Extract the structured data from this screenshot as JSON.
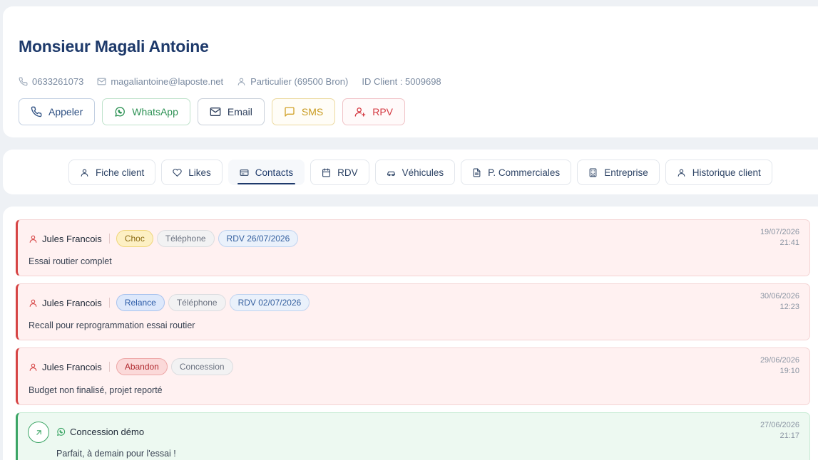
{
  "client": {
    "name": "Monsieur Magali Antoine",
    "phone": "0633261073",
    "email": "magaliantoine@laposte.net",
    "type": "Particulier (69500 Bron)",
    "id": "ID Client : 5009698"
  },
  "actions": {
    "call": "Appeler",
    "whatsapp": "WhatsApp",
    "email": "Email",
    "sms": "SMS",
    "rpv": "RPV"
  },
  "tabs": [
    {
      "label": "Fiche client",
      "icon": "user-icon"
    },
    {
      "label": "Likes",
      "icon": "heart-icon"
    },
    {
      "label": "Contacts",
      "icon": "id-card-icon",
      "active": true
    },
    {
      "label": "RDV",
      "icon": "calendar-icon"
    },
    {
      "label": "Véhicules",
      "icon": "car-icon"
    },
    {
      "label": "P. Commerciales",
      "icon": "document-icon"
    },
    {
      "label": "Entreprise",
      "icon": "building-icon"
    },
    {
      "label": "Historique client",
      "icon": "user-icon"
    }
  ],
  "contacts": [
    {
      "author": "Jules Francois",
      "status": "Choc",
      "channel": "Téléphone",
      "rdv": "RDV 26/07/2026",
      "text": "Essai routier complet",
      "date": "19/07/2026",
      "time": "21:41"
    },
    {
      "author": "Jules Francois",
      "status": "Relance",
      "channel": "Téléphone",
      "rdv": "RDV 02/07/2026",
      "text": "Recall pour reprogrammation essai routier",
      "date": "30/06/2026",
      "time": "12:23"
    },
    {
      "author": "Jules Francois",
      "status": "Abandon",
      "channel": "Concession",
      "text": "Budget non finalisé, projet reporté",
      "date": "29/06/2026",
      "time": "19:10"
    },
    {
      "author": "Concession démo",
      "text": "Parfait, à demain pour l'essai !",
      "date": "27/06/2026",
      "time": "21:17"
    }
  ],
  "colors": {
    "primary": "#1e3a6b",
    "danger": "#d64545",
    "success": "#3ba565",
    "warning": "#d1a22a"
  }
}
